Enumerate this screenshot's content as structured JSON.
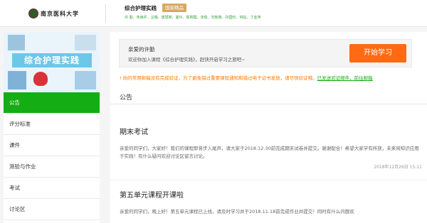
{
  "header": {
    "logo_text": "南京医科大学",
    "course_title": "综合护理实践",
    "badge": "国家精品",
    "teachers": "许 勤、朱焕芹、汪璐、唐慧婷、夏玲、陈明霞、张俊、刘知英、孙国珍、林征、丁亚萍"
  },
  "sidebar": {
    "banner_title": "综合护理实践",
    "menu": [
      {
        "label": "公告",
        "active": true
      },
      {
        "label": "评分标准",
        "active": false
      },
      {
        "label": "课件",
        "active": false
      },
      {
        "label": "测验与作业",
        "active": false
      },
      {
        "label": "考试",
        "active": false
      },
      {
        "label": "讨论区",
        "active": false
      }
    ]
  },
  "welcome": {
    "title": "亲爱的许勤",
    "desc": "欢迎你加入课程《综合护理实践》，赶快开启学习之旅吧~",
    "start_button": "开始学习"
  },
  "warning": {
    "text": "你的常用邮箱没有完成验证，为了避免错过重要课程通知和错过电子证书发放，请尽快验证哦。",
    "link1": "已发送验证邮件，前往邮箱"
  },
  "announcements": {
    "section_title": "公告",
    "posts": [
      {
        "title": "期末考试",
        "body": "亲爱的同学们，大家好！我们的课程即将步入尾声，请大家于2018.12.30前完成期末试卷并提交。谢谢配合！希望大家学有所获，未来将知识应用于实践！有什么疑问欢迎讨论区留言讨论。",
        "time": "2018年12月26日 15:11"
      },
      {
        "title": "第五单元课程开课啦",
        "body": "亲爱的同学们，晚上好！第五单元课程已上线，请及时学习并于2018.11.18前完成作业并提交！同时有什么问题欢"
      }
    ]
  }
}
